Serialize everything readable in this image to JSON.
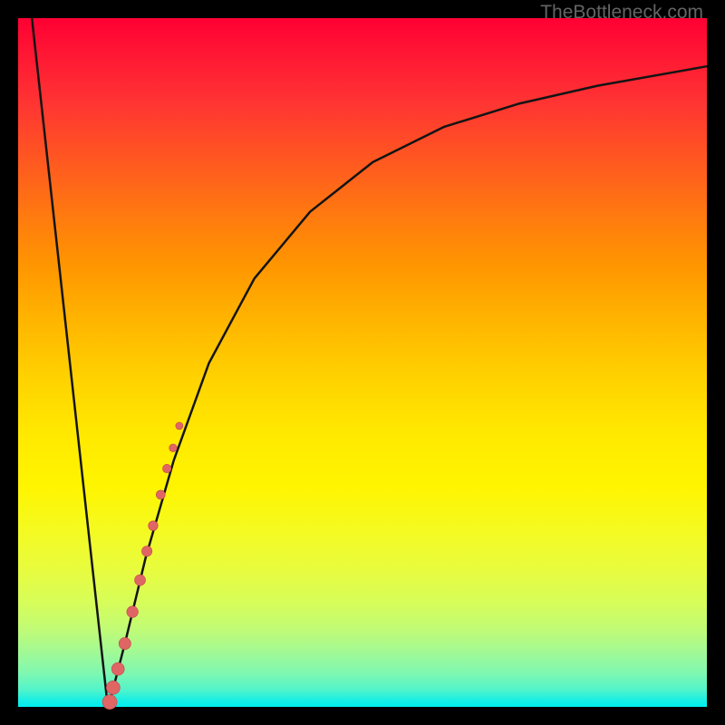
{
  "watermark": {
    "text": "TheBottleneck.com"
  },
  "chart_data": {
    "type": "line",
    "title": "",
    "xlabel": "",
    "ylabel": "",
    "xlim": [
      0,
      100
    ],
    "ylim": [
      0,
      100
    ],
    "series": [
      {
        "name": "bottleneck-curve",
        "x": [
          2,
          12.9,
          13.3,
          15.5,
          18.5,
          22.6,
          27.7,
          34.3,
          42.4,
          51.5,
          61.8,
          72.8,
          84.2,
          100
        ],
        "values": [
          100,
          1.1,
          0.7,
          9.2,
          21.6,
          35.8,
          49.9,
          62.2,
          71.9,
          79.1,
          84.2,
          87.6,
          90.2,
          93
        ]
      }
    ],
    "highlight_points": {
      "name": "highlight-dots",
      "x": [
        13.3,
        13.8,
        14.5,
        15.5,
        16.6,
        17.7,
        18.7,
        19.6,
        20.7,
        21.6,
        22.5,
        23.4
      ],
      "values": [
        0.7,
        2.8,
        5.5,
        9.2,
        13.8,
        18.4,
        22.6,
        26.3,
        30.8,
        34.6,
        37.6,
        40.8
      ],
      "radii": [
        8,
        7.5,
        7,
        6.6,
        6.3,
        6,
        5.7,
        5.3,
        5,
        4.7,
        4.3,
        4
      ]
    },
    "colors": {
      "curve": "#141414",
      "dots": "#e06666",
      "dots_stroke": "#c44545"
    }
  }
}
